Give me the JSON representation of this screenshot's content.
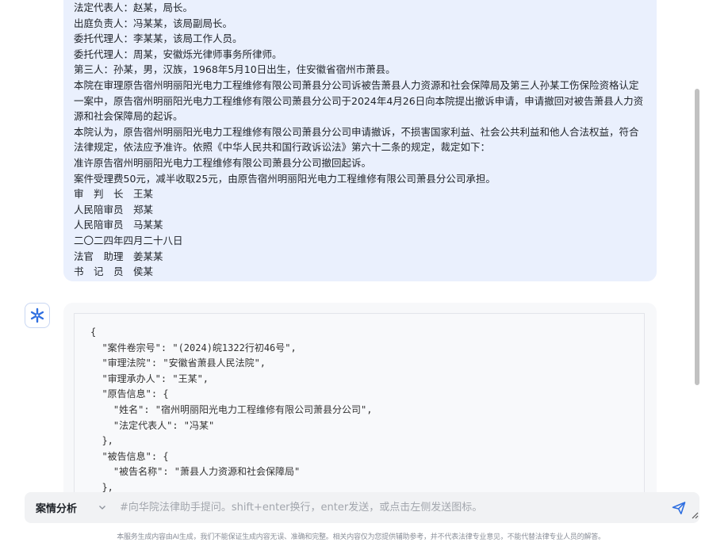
{
  "user_message": {
    "lines": [
      "法定代表人：赵某，局长。",
      "出庭负责人：冯某某，该局副局长。",
      "委托代理人：李某某，该局工作人员。",
      "委托代理人：周某，安徽烁光律师事务所律师。",
      "第三人：孙某，男，汉族，1968年5月10日出生，住安徽省宿州市萧县。",
      "本院在审理原告宿州明丽阳光电力工程维修有限公司萧县分公司诉被告萧县人力资源和社会保障局及第三人孙某工伤保险资格认定一案中，原告宿州明丽阳光电力工程维修有限公司萧县分公司于2024年4月26日向本院提出撤诉申请，申请撤回对被告萧县人力资源和社会保障局的起诉。",
      "本院认为，原告宿州明丽阳光电力工程维修有限公司萧县分公司申请撤诉，不损害国家利益、社会公共利益和他人合法权益，符合法律规定，依法应予准许。依照《中华人民共和国行政诉讼法》第六十二条的规定，裁定如下：",
      "准许原告宿州明丽阳光电力工程维修有限公司萧县分公司撤回起诉。",
      "案件受理费50元，减半收取25元，由原告宿州明丽阳光电力工程维修有限公司萧县分公司承担。",
      "审　判　长　王某",
      "人民陪审员　郑某",
      "人民陪审员　马某某",
      "二〇二四年四月二十八日",
      "法官　助理　姜某某",
      "书　记　员　侯某"
    ]
  },
  "assistant_reply": {
    "avatar_icon": "snowflake-logo-icon",
    "code_lines": [
      "{",
      "  \"案件卷宗号\": \"(2024)皖1322行初46号\",",
      "  \"审理法院\": \"安徽省萧县人民法院\",",
      "  \"审理承办人\": \"王某\",",
      "  \"原告信息\": {",
      "    \"姓名\": \"宿州明丽阳光电力工程维修有限公司萧县分公司\",",
      "    \"法定代表人\": \"冯某\"",
      "  },",
      "  \"被告信息\": {",
      "    \"被告名称\": \"萧县人力资源和社会保障局\"",
      "  },"
    ]
  },
  "input_bar": {
    "mode_label": "案情分析",
    "mode_icon": "chevron-down-icon",
    "placeholder": "#向华院法律助手提问。shift+enter换行，enter发送，或点击左侧发送图标。",
    "value": "",
    "send_icon": "send-icon"
  },
  "disclaimer": "本服务生成内容由AI生成，我们不能保证生成内容无误、准确和完整。相关内容仅为您提供辅助参考，并不代表法律专业意见，不能代替法律专业人员的解答。",
  "colors": {
    "user_bubble": "#eaf0fd",
    "accent": "#2f6fe0",
    "input_bg": "#f1f2f4"
  }
}
